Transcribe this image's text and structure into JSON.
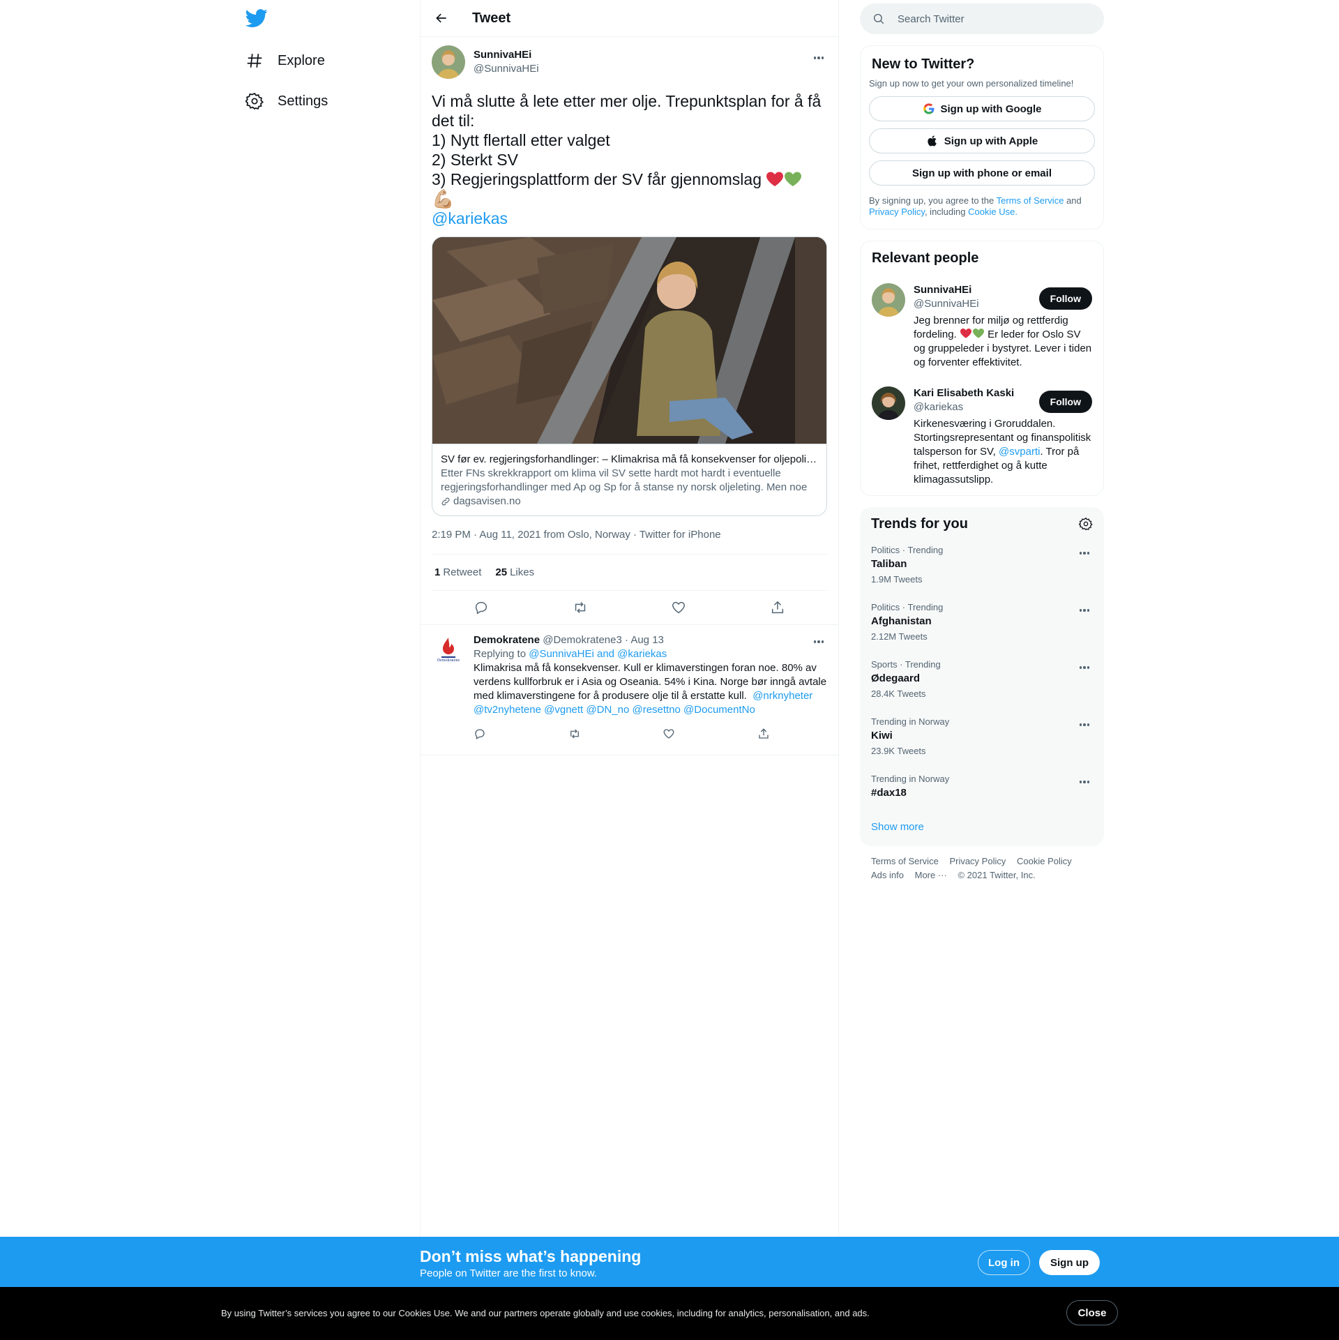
{
  "nav": {
    "logo_icon": "twitter-bird-icon",
    "items": [
      {
        "label": "Explore",
        "icon": "hashtag-icon"
      },
      {
        "label": "Settings",
        "icon": "gear-icon"
      }
    ]
  },
  "header": {
    "title": "Tweet"
  },
  "tweet": {
    "display_name": "SunnivaHEi",
    "handle": "@SunnivaHEi",
    "text_lines": [
      "Vi må slutte å lete etter mer olje. Trepunktsplan for å få",
      "det til:",
      "1) Nytt flertall etter valget",
      "2) Sterkt SV",
      "3) Regjeringsplattform der SV får gjennomslag"
    ],
    "emoji_muscle": "💪🏼",
    "mention": "@kariekas",
    "card": {
      "title": "SV før ev. regjeringsforhandlinger: – Klimakrisa må få konsekvenser for oljepolitikken",
      "description": "Etter FNs skrekkrapport om klima vil SV sette hardt mot hardt i eventuelle regjeringsforhandlinger med Ap og Sp for å stanse ny norsk oljeleting. Men noe …",
      "domain": "dagsavisen.no"
    },
    "meta": "2:19 PM · Aug 11, 2021 from Oslo, Norway · Twitter for iPhone",
    "retweets": "1",
    "retweets_label": "Retweet",
    "likes": "25",
    "likes_label": "Likes"
  },
  "reply": {
    "display_name": "Demokratene",
    "handle_date": "@Demokratene3 · Aug 13",
    "replying_prefix": "Replying to",
    "replying_to": "@SunnivaHEi and @kariekas",
    "text": "Klimakrisa må få konsekvenser. Kull er klimaverstingen foran noe. 80% av verdens kullforbruk er i Asia og Oseania. 54% i Kina. Norge bør inngå avtale med klimaverstingene for å produsere olje til å erstatte kull.",
    "mentions_line1": "@nrknyheter",
    "mentions_line2": "@tv2nyhetene @vgnett @DN_no @resettno @DocumentNo"
  },
  "search": {
    "placeholder": "Search Twitter"
  },
  "signup": {
    "title": "New to Twitter?",
    "subtitle": "Sign up now to get your own personalized timeline!",
    "google": "Sign up with Google",
    "apple": "Sign up with Apple",
    "phone": "Sign up with phone or email",
    "legal_1": "By signing up, you agree to the",
    "terms": "Terms of Service",
    "legal_2": "and",
    "privacy": "Privacy Policy",
    "legal_3": ", including",
    "cookie": "Cookie Use."
  },
  "relevant": {
    "title": "Relevant people",
    "people": [
      {
        "name": "SunnivaHEi",
        "handle": "@SunnivaHEi",
        "follow": "Follow",
        "bio_1": "Jeg brenner for miljø og rettferdig fordeling.",
        "bio_2": "Er leder for Oslo SV og gruppeleder i bystyret. Lever i tiden og forventer effektivitet."
      },
      {
        "name": "Kari Elisabeth Kaski",
        "handle": "@kariekas",
        "follow": "Follow",
        "bio_1": "Kirkenesværing i Groruddalen. Stortingsrepresentant og finanspolitisk talsperson for SV,",
        "bio_mention": "@svparti",
        "bio_2": ". Tror på frihet, rettferdighet og å kutte klimagassutslipp."
      }
    ]
  },
  "trends": {
    "title": "Trends for you",
    "items": [
      {
        "category": "Politics · Trending",
        "name": "Taliban",
        "count": "1.9M Tweets"
      },
      {
        "category": "Politics · Trending",
        "name": "Afghanistan",
        "count": "2.12M Tweets"
      },
      {
        "category": "Sports · Trending",
        "name": "Ødegaard",
        "count": "28.4K Tweets"
      },
      {
        "category": "Trending in Norway",
        "name": "Kiwi",
        "count": "23.9K Tweets"
      },
      {
        "category": "Trending in Norway",
        "name": "#dax18",
        "count": ""
      }
    ],
    "show_more": "Show more"
  },
  "footer": {
    "links": [
      "Terms of Service",
      "Privacy Policy",
      "Cookie Policy",
      "Ads info",
      "More ···",
      "© 2021 Twitter, Inc."
    ]
  },
  "bottom_bar": {
    "title": "Don’t miss what’s happening",
    "subtitle": "People on Twitter are the first to know.",
    "login": "Log in",
    "signup": "Sign up"
  },
  "cookie_bar": {
    "text": "By using Twitter’s services you agree to our Cookies Use. We and our partners operate globally and use cookies, including for analytics, personalisation, and ads.",
    "close": "Close"
  },
  "colors": {
    "accent": "#1d9bf0",
    "text": "#0f1419",
    "secondary": "#536471",
    "border": "#eff3f4",
    "cookie_bg": "#000000"
  }
}
